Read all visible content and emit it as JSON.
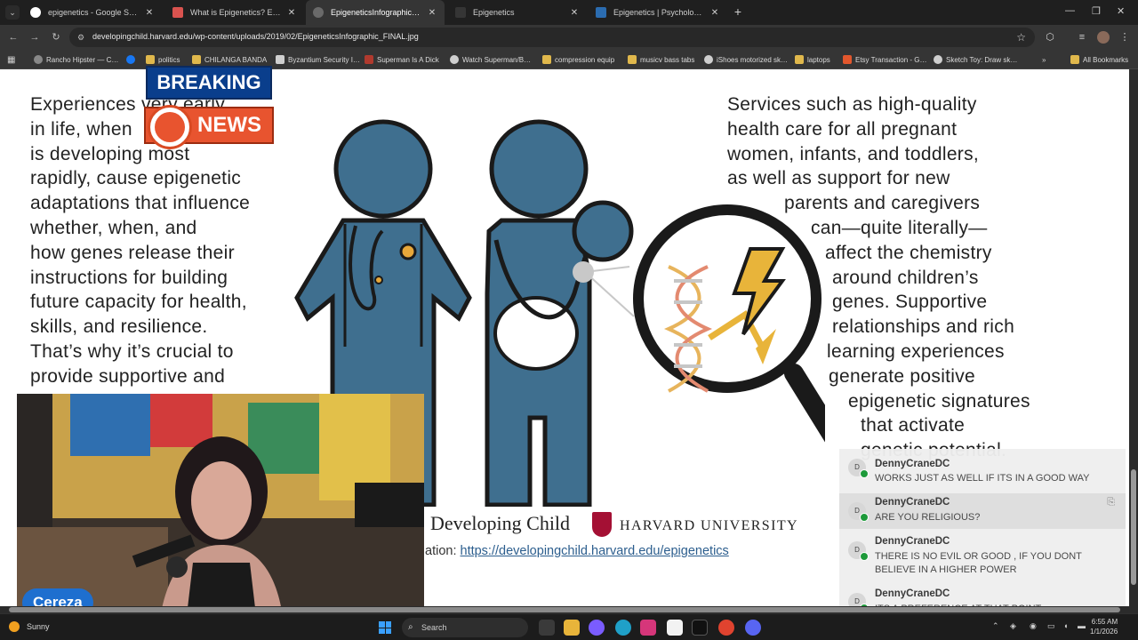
{
  "browser": {
    "tabs": [
      {
        "title": "epigenetics - Google Search",
        "favicon_color": "#ffffff",
        "active": false
      },
      {
        "title": "What is Epigenetics? Experien…",
        "favicon_color": "#d9534f",
        "active": false
      },
      {
        "title": "EpigeneticsInfographic_FINAL.jp",
        "favicon_color": "#6a6a6a",
        "active": true
      },
      {
        "title": "Epigenetics",
        "favicon_color": "#353535",
        "active": false
      },
      {
        "title": "Epigenetics | Psychology Today",
        "favicon_color": "#2b6cb0",
        "active": false
      }
    ],
    "url": "developingchild.harvard.edu/wp-content/uploads/2019/02/EpigeneticsInfographic_FINAL.jpg",
    "bookmarks": [
      {
        "label": "Rancho Hipster — C…",
        "color": "#888888"
      },
      {
        "label": "",
        "color": "#1877f2"
      },
      {
        "label": "politics",
        "color": "#e0b84c"
      },
      {
        "label": "CHILANGA BANDA",
        "color": "#e0b84c"
      },
      {
        "label": "Byzantium Security I…",
        "color": "#cfcfcf"
      },
      {
        "label": "Superman Is A Dick",
        "color": "#b03a2e"
      },
      {
        "label": "Watch Superman/B…",
        "color": "#cfcfcf"
      },
      {
        "label": "compression equip",
        "color": "#e0b84c"
      },
      {
        "label": "musicv bass tabs",
        "color": "#e0b84c"
      },
      {
        "label": "iShoes motorized sk…",
        "color": "#cfcfcf"
      },
      {
        "label": "laptops",
        "color": "#e0b84c"
      },
      {
        "label": "Etsy Transaction - G…",
        "color": "#e2572d"
      },
      {
        "label": "Sketch Toy: Draw sk…",
        "color": "#cfcfcf"
      },
      {
        "label": "All Bookmarks",
        "color": "#e0b84c"
      }
    ]
  },
  "infographic": {
    "left_lines": [
      "Experiences very early",
      "in life, when",
      "is developing most",
      "rapidly, cause epigenetic",
      "adaptations that influence",
      "whether, when, and",
      "how genes release their",
      "instructions for building",
      "future capacity for health,",
      "skills, and resilience.",
      "That’s why it’s crucial to",
      "provide supportive and"
    ],
    "right_lines": [
      {
        "text": "Services such as high-quality",
        "indent": 0
      },
      {
        "text": "health care for all pregnant",
        "indent": 0
      },
      {
        "text": "women, infants, and toddlers,",
        "indent": 0
      },
      {
        "text": "as well as support for new",
        "indent": 0
      },
      {
        "text": "parents and caregivers",
        "indent": 64
      },
      {
        "text": "can—quite literally—",
        "indent": 94
      },
      {
        "text": "affect the chemistry",
        "indent": 110
      },
      {
        "text": "around children’s",
        "indent": 118
      },
      {
        "text": "genes. Supportive",
        "indent": 118
      },
      {
        "text": "relationships and rich",
        "indent": 118
      },
      {
        "text": "learning experiences",
        "indent": 112
      },
      {
        "text": "generate positive",
        "indent": 114
      },
      {
        "text": "epigenetic signatures",
        "indent": 136
      },
      {
        "text": "that activate",
        "indent": 150
      },
      {
        "text": "genetic potential.",
        "indent": 150
      }
    ],
    "logo_text": "Developing Child",
    "university": "HARVARD UNIVERSITY",
    "info_prefix": "ation: ",
    "info_link": "https://developingchild.harvard.edu/epigenetics"
  },
  "overlay": {
    "breaking": "BREAKING",
    "news": "NEWS",
    "streamer_name": "Cereza"
  },
  "chat": {
    "messages": [
      {
        "initials": "D",
        "user": "DennyCraneDC",
        "text": "WORKS JUST AS WELL IF ITS IN A GOOD WAY"
      },
      {
        "initials": "D",
        "user": "DennyCraneDC",
        "text": "ARE YOU RELIGIOUS?"
      },
      {
        "initials": "D",
        "user": "DennyCraneDC",
        "text": "THERE IS NO EVIL OR GOOD , IF YOU DONT BELIEVE IN A HIGHER POWER"
      },
      {
        "initials": "D",
        "user": "DennyCraneDC",
        "text": "ITS A PREFERENCE AT THAT POINT"
      }
    ]
  },
  "taskbar": {
    "weather": "Sunny",
    "search_placeholder": "Search",
    "time": "6:55 AM",
    "date": "1/1/2026"
  },
  "colors": {
    "figure_blue": "#3f6f8f",
    "outline": "#1a1a1a",
    "accent_orange": "#e8542f",
    "breaking_blue": "#0a3e8c"
  }
}
